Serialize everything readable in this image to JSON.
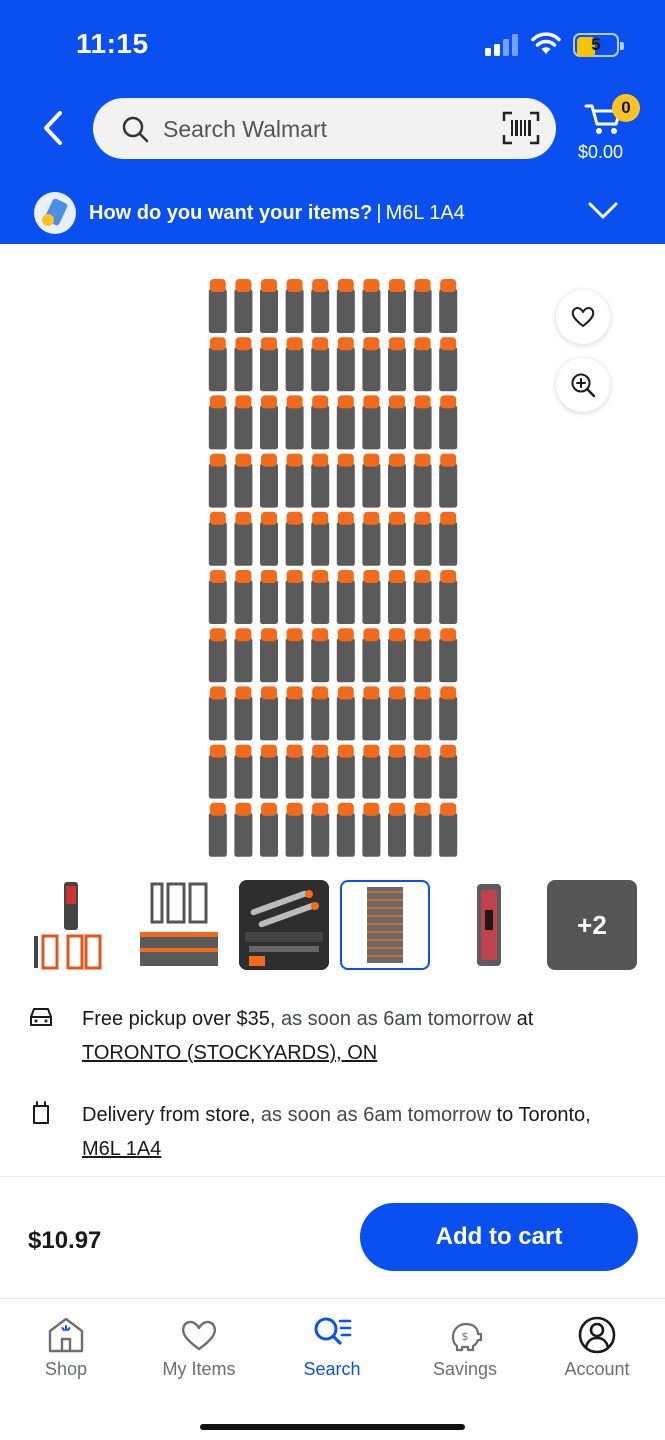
{
  "status_bar": {
    "time": "11:15",
    "battery": "5"
  },
  "header": {
    "search_placeholder": "Search Walmart",
    "cart_count": "0",
    "cart_total": "$0.00",
    "fulfillment_question": "How do you want your items?",
    "fulfillment_separator": "|",
    "postal_code": "M6L 1A4"
  },
  "product": {
    "image_rows": 10,
    "image_cols": 10,
    "thumbnails_more": "+2",
    "price": "$10.97",
    "add_to_cart": "Add to cart"
  },
  "fulfillment_options": {
    "pickup": {
      "strong": "Free pickup over $35,",
      "light": " as soon as 6am tomorrow",
      "tail": " at",
      "store_link": "TORONTO (STOCKYARDS), ON"
    },
    "delivery": {
      "strong": "Delivery from store,",
      "light": " as soon as 6am tomorrow",
      "tail": " to Toronto,",
      "postal_link": "M6L 1A4"
    }
  },
  "bottom_nav": {
    "items": [
      {
        "label": "Shop",
        "icon": "store-icon"
      },
      {
        "label": "My Items",
        "icon": "heart-icon"
      },
      {
        "label": "Search",
        "icon": "search-list-icon",
        "active": true
      },
      {
        "label": "Savings",
        "icon": "piggy-bank-icon"
      },
      {
        "label": "Account",
        "icon": "account-icon"
      }
    ]
  },
  "colors": {
    "brand_blue": "#0a50f0",
    "cart_badge": "#ffc220",
    "dart_tip": "#f26a1b",
    "dart_body": "#5a5a5a"
  }
}
